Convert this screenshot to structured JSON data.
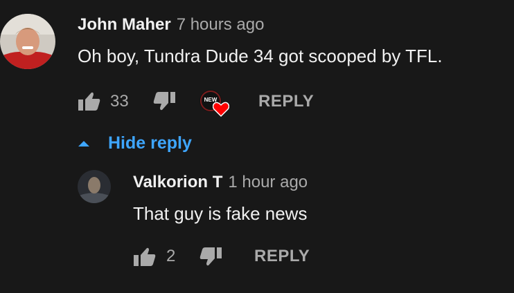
{
  "comment": {
    "author": "John Maher",
    "time": "7 hours ago",
    "text": "Oh boy, Tundra Dude 34 got scooped by TFL.",
    "likes": "33",
    "creator_badge": "NEW",
    "reply_label": "REPLY"
  },
  "thread": {
    "toggle_label": "Hide reply"
  },
  "reply": {
    "author": "Valkorion T",
    "time": "1 hour ago",
    "text": "That guy is fake news",
    "likes": "2",
    "reply_label": "REPLY"
  },
  "colors": {
    "background": "#181818",
    "primary_text": "#f1f1f1",
    "secondary_text": "#aaaaaa",
    "link": "#3ea6ff",
    "heart": "#ff0000"
  },
  "icons": {
    "like": "thumbs-up-icon",
    "dislike": "thumbs-down-icon",
    "heart": "heart-icon",
    "toggle": "caret-up-icon"
  }
}
